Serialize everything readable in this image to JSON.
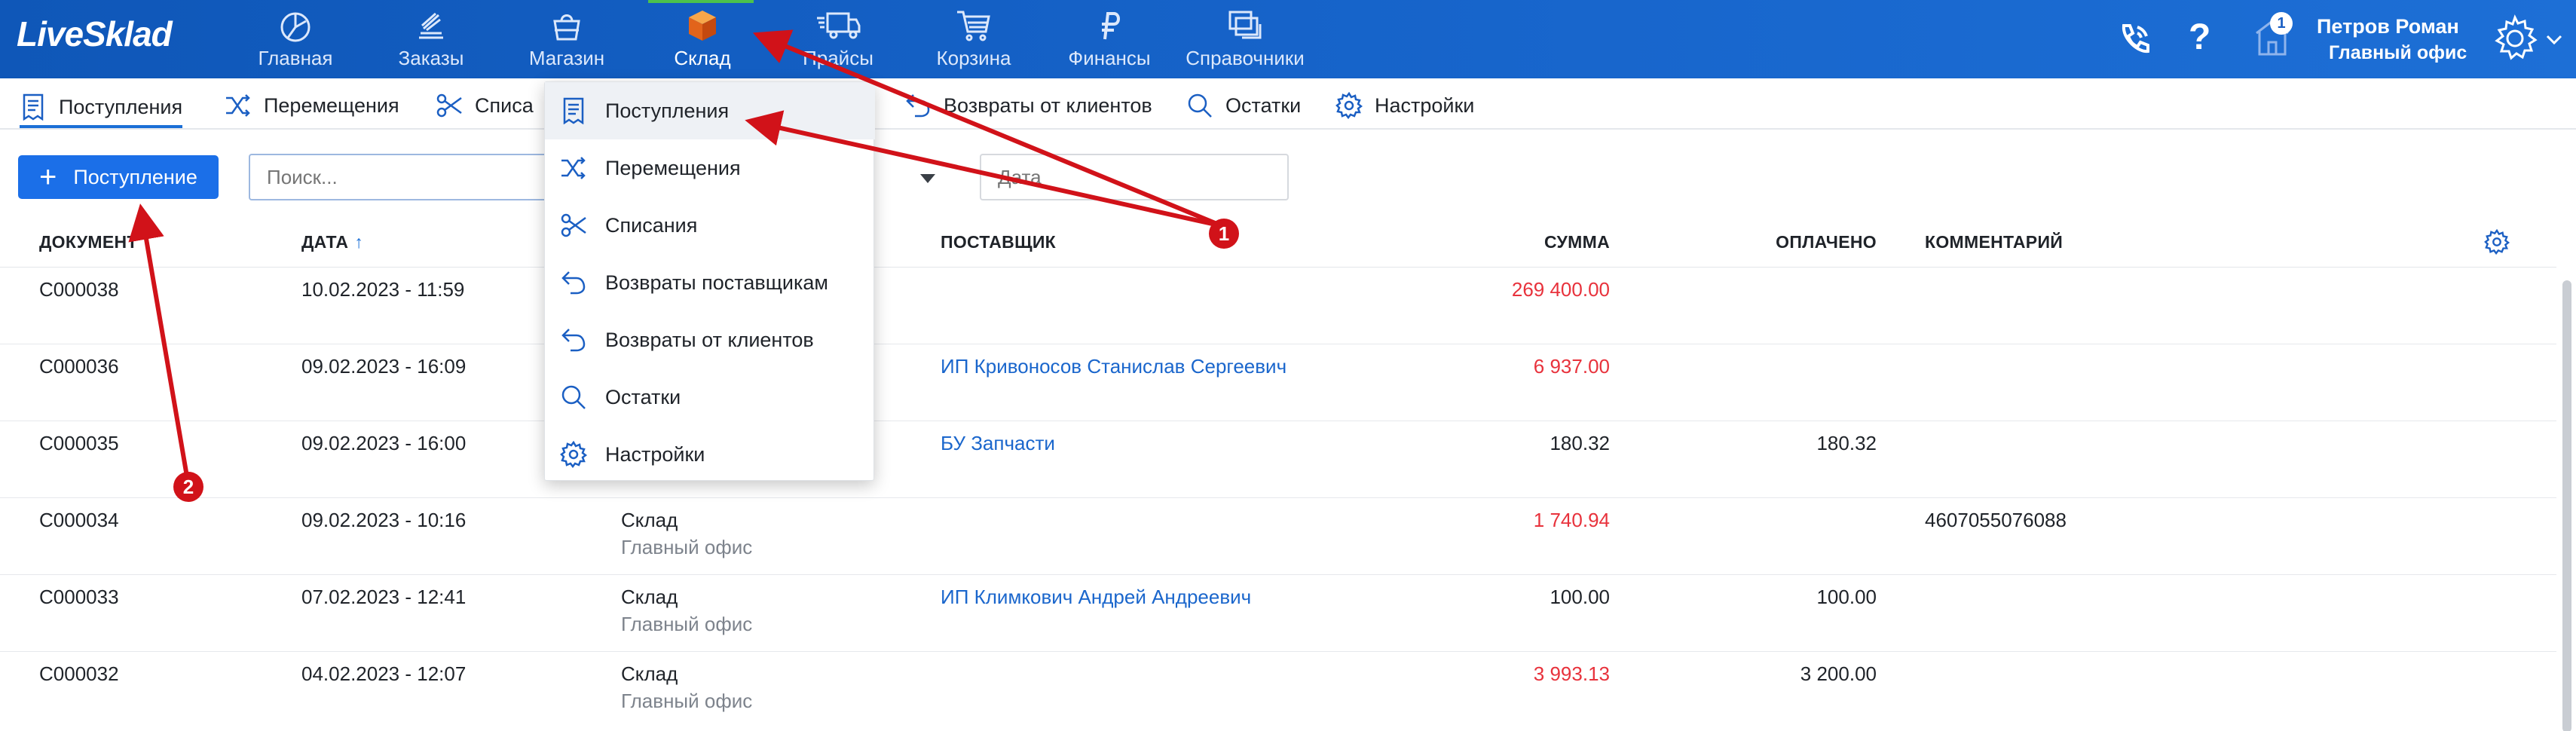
{
  "app": {
    "logo": "LiveSklad"
  },
  "nav": {
    "items": [
      {
        "label": "Главная",
        "icon": "dashboard-icon"
      },
      {
        "label": "Заказы",
        "icon": "orders-icon"
      },
      {
        "label": "Магазин",
        "icon": "shop-bag-icon"
      },
      {
        "label": "Склад",
        "icon": "warehouse-box-icon",
        "active": true
      },
      {
        "label": "Прайсы",
        "icon": "truck-icon"
      },
      {
        "label": "Корзина",
        "icon": "cart-icon"
      },
      {
        "label": "Финансы",
        "icon": "ruble-icon"
      },
      {
        "label": "Справочники",
        "icon": "directories-icon"
      }
    ],
    "notifications_count": "1",
    "help_label": "?"
  },
  "user": {
    "name": "Петров Роман",
    "office": "Главный офис"
  },
  "subnav": {
    "items": [
      {
        "label": "Поступления",
        "active": true
      },
      {
        "label": "Перемещения"
      },
      {
        "label": "Списа"
      },
      {
        "label": "Возвраты от клиентов"
      },
      {
        "label": "Остатки"
      },
      {
        "label": "Настройки"
      }
    ]
  },
  "toolbar": {
    "add_button": "Поступление",
    "search_placeholder": "Поиск...",
    "date_placeholder": "Дата"
  },
  "table": {
    "columns": {
      "document": "ДОКУМЕНТ",
      "date": "ДАТА",
      "supplier": "ПОСТАВЩИК",
      "sum": "СУММА",
      "paid": "ОПЛАЧЕНО",
      "comment": "КОММЕНТАРИЙ"
    },
    "rows": [
      {
        "doc": "C000038",
        "date": "10.02.2023 - 11:59",
        "warehouse": "",
        "office": "",
        "supplier": "",
        "sum": "269 400.00",
        "sum_negative": true,
        "paid": "",
        "comment": ""
      },
      {
        "doc": "C000036",
        "date": "09.02.2023 - 16:09",
        "warehouse": "",
        "office": "",
        "supplier": "ИП Кривоносов Станислав Сергеевич",
        "sum": "6 937.00",
        "sum_negative": true,
        "paid": "",
        "comment": ""
      },
      {
        "doc": "C000035",
        "date": "09.02.2023 - 16:00",
        "warehouse": "",
        "office": "",
        "supplier": "БУ Запчасти",
        "sum": "180.32",
        "sum_negative": false,
        "paid": "180.32",
        "comment": ""
      },
      {
        "doc": "C000034",
        "date": "09.02.2023 - 10:16",
        "warehouse": "Склад",
        "office": "Главный офис",
        "supplier": "",
        "sum": "1 740.94",
        "sum_negative": true,
        "paid": "",
        "comment": "4607055076088"
      },
      {
        "doc": "C000033",
        "date": "07.02.2023 - 12:41",
        "warehouse": "Склад",
        "office": "Главный офис",
        "supplier": "ИП Климкович Андрей Андреевич",
        "sum": "100.00",
        "sum_negative": false,
        "paid": "100.00",
        "comment": ""
      },
      {
        "doc": "C000032",
        "date": "04.02.2023 - 12:07",
        "warehouse": "Склад",
        "office": "Главный офис",
        "supplier": "",
        "sum": "3 993.13",
        "sum_negative": true,
        "paid": "3 200.00",
        "comment": ""
      }
    ]
  },
  "dropdown": {
    "items": [
      {
        "label": "Поступления",
        "icon": "receipt-icon"
      },
      {
        "label": "Перемещения",
        "icon": "shuffle-icon"
      },
      {
        "label": "Списания",
        "icon": "scissors-icon"
      },
      {
        "label": "Возвраты поставщикам",
        "icon": "return-icon"
      },
      {
        "label": "Возвраты от клиентов",
        "icon": "return-icon"
      },
      {
        "label": "Остатки",
        "icon": "search-icon"
      },
      {
        "label": "Настройки",
        "icon": "gear-icon"
      }
    ]
  },
  "annotations": {
    "marker1": "1",
    "marker2": "2"
  },
  "colors": {
    "nav_bg": "#1663c9",
    "accent": "#1b6fe8",
    "negative": "#e8323c",
    "link": "#1a66cc",
    "annotation": "#d11219"
  }
}
